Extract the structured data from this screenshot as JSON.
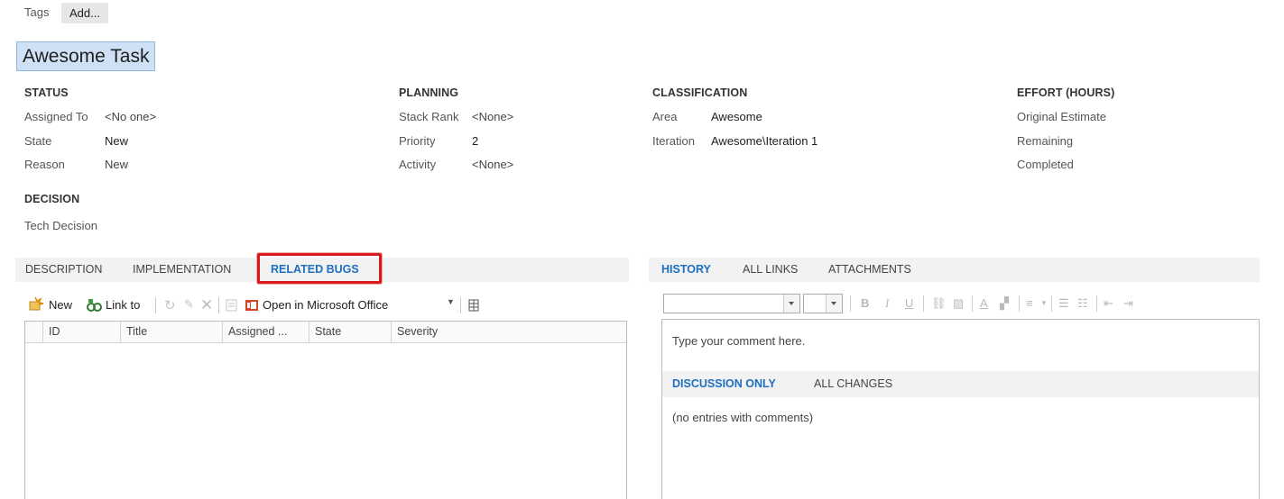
{
  "tags": {
    "label": "Tags",
    "add_label": "Add..."
  },
  "title": "Awesome Task",
  "status": {
    "header": "STATUS",
    "assigned_to_label": "Assigned To",
    "assigned_to_value": "<No one>",
    "state_label": "State",
    "state_value": "New",
    "reason_label": "Reason",
    "reason_value": "New"
  },
  "planning": {
    "header": "PLANNING",
    "stack_rank_label": "Stack Rank",
    "stack_rank_value": "<None>",
    "priority_label": "Priority",
    "priority_value": "2",
    "activity_label": "Activity",
    "activity_value": "<None>"
  },
  "classification": {
    "header": "CLASSIFICATION",
    "area_label": "Area",
    "area_value": "Awesome",
    "iteration_label": "Iteration",
    "iteration_value": "Awesome\\Iteration 1"
  },
  "effort": {
    "header": "EFFORT (HOURS)",
    "original_estimate_label": "Original Estimate",
    "remaining_label": "Remaining",
    "completed_label": "Completed"
  },
  "decision": {
    "header": "DECISION",
    "tech_decision_label": "Tech Decision"
  },
  "left_tabs": {
    "description": "DESCRIPTION",
    "implementation": "IMPLEMENTATION",
    "related_bugs": "RELATED BUGS",
    "active": "RELATED BUGS"
  },
  "links_toolbar": {
    "new_label": "New",
    "link_to_label": "Link to",
    "open_office_label": "Open in Microsoft Office"
  },
  "grid": {
    "columns": [
      "ID",
      "Title",
      "Assigned ...",
      "State",
      "Severity"
    ],
    "rows": []
  },
  "right_tabs": {
    "history": "HISTORY",
    "all_links": "ALL LINKS",
    "attachments": "ATTACHMENTS",
    "active": "HISTORY"
  },
  "history": {
    "comment_placeholder": "Type your comment here.",
    "discussion_only": "DISCUSSION ONLY",
    "all_changes": "ALL CHANGES",
    "empty_text": "(no entries with comments)"
  },
  "colors": {
    "accent": "#1f6fbf",
    "highlight_border": "#d91a1a",
    "title_selection": "#cfe2f5"
  }
}
